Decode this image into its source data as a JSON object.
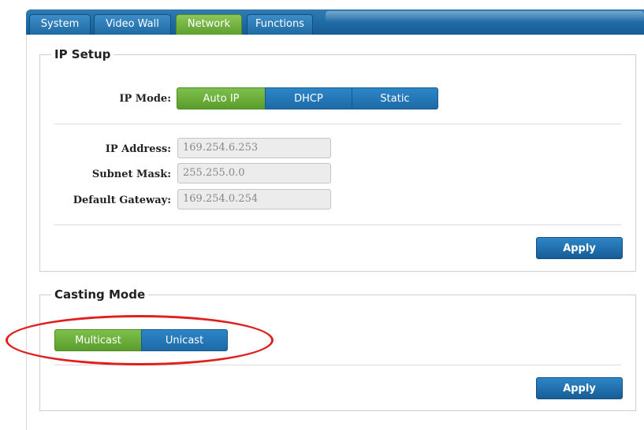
{
  "tabs": [
    {
      "label": "System"
    },
    {
      "label": "Video Wall"
    },
    {
      "label": "Network"
    },
    {
      "label": "Functions"
    }
  ],
  "active_tab": "Network",
  "ip_setup": {
    "legend": "IP Setup",
    "mode_label": "IP Mode:",
    "modes": [
      "Auto IP",
      "DHCP",
      "Static"
    ],
    "selected_mode": "Auto IP",
    "ip_address_label": "IP Address:",
    "ip_address_value": "169.254.6.253",
    "subnet_label": "Subnet Mask:",
    "subnet_value": "255.255.0.0",
    "gateway_label": "Default Gateway:",
    "gateway_value": "169.254.0.254",
    "apply_label": "Apply"
  },
  "casting": {
    "legend": "Casting Mode",
    "modes": [
      "Multicast",
      "Unicast"
    ],
    "selected_mode": "Multicast",
    "apply_label": "Apply"
  },
  "colors": {
    "tab_blue": "#1f6aa3",
    "active_green": "#6aab3a",
    "highlight_red": "#e0201f"
  }
}
